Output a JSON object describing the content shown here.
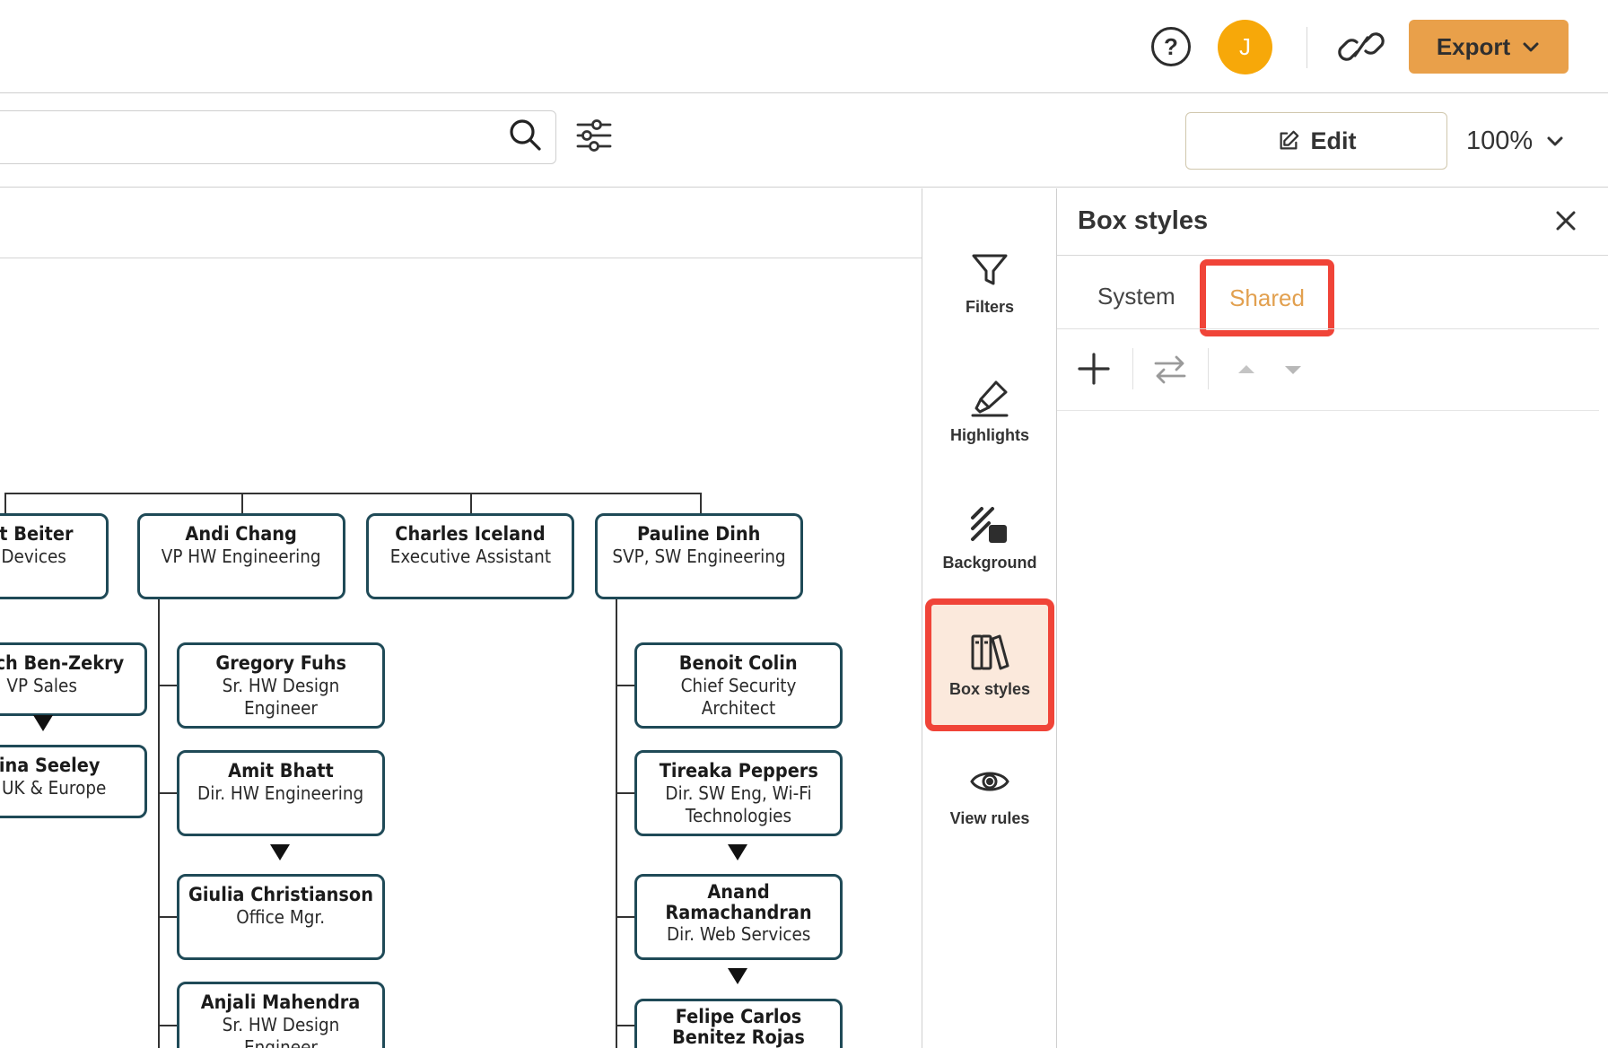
{
  "header": {
    "help_icon": "question-circle-icon",
    "avatar_initial": "J",
    "avatar_color": "#f7a809",
    "link_icon": "link-icon",
    "export_label": "Export",
    "export_color": "#e9a04a"
  },
  "toolbar": {
    "search_placeholder": "",
    "edit_label": "Edit",
    "zoom": "100%"
  },
  "org_chart": {
    "top_row": [
      {
        "name": "et Beiter",
        "title": ", Devices"
      },
      {
        "name": "Andi Chang",
        "title": "VP HW Engineering"
      },
      {
        "name": "Charles Iceland",
        "title": "Executive Assistant"
      },
      {
        "name": "Pauline Dinh",
        "title": "SVP, SW Engineering"
      }
    ],
    "left_column": [
      {
        "name": "uch Ben-Zekry",
        "title": "VP Sales"
      },
      {
        "name": "rina Seeley",
        "title": "UK & Europe"
      }
    ],
    "andi_reports": [
      {
        "name": "Gregory Fuhs",
        "title": "Sr. HW Design Engineer"
      },
      {
        "name": "Amit Bhatt",
        "title": "Dir. HW Engineering"
      },
      {
        "name": "Giulia Christianson",
        "title": "Office Mgr."
      },
      {
        "name": "Anjali Mahendra",
        "title": "Sr. HW Design Engineer"
      }
    ],
    "pauline_reports": [
      {
        "name": "Benoit Colin",
        "title": "Chief Security Architect"
      },
      {
        "name": "Tireaka Peppers",
        "title": "Dir. SW Eng, Wi-Fi Technologies"
      },
      {
        "name": "Anand Ramachandran",
        "title": "Dir. Web Services"
      },
      {
        "name": "Felipe Carlos Benitez Rojas",
        "title": ""
      }
    ],
    "box_border_color": "#1f4a57"
  },
  "rail": {
    "items": [
      {
        "label": "Filters",
        "icon": "funnel-icon"
      },
      {
        "label": "Highlights",
        "icon": "highlighter-icon"
      },
      {
        "label": "Background",
        "icon": "background-icon"
      },
      {
        "label": "Box styles",
        "icon": "books-icon",
        "active": true
      },
      {
        "label": "View rules",
        "icon": "eye-icon"
      }
    ]
  },
  "panel": {
    "title": "Box styles",
    "tabs": [
      {
        "label": "System"
      },
      {
        "label": "Shared",
        "active": true
      }
    ],
    "highlight_color": "#f04438"
  }
}
